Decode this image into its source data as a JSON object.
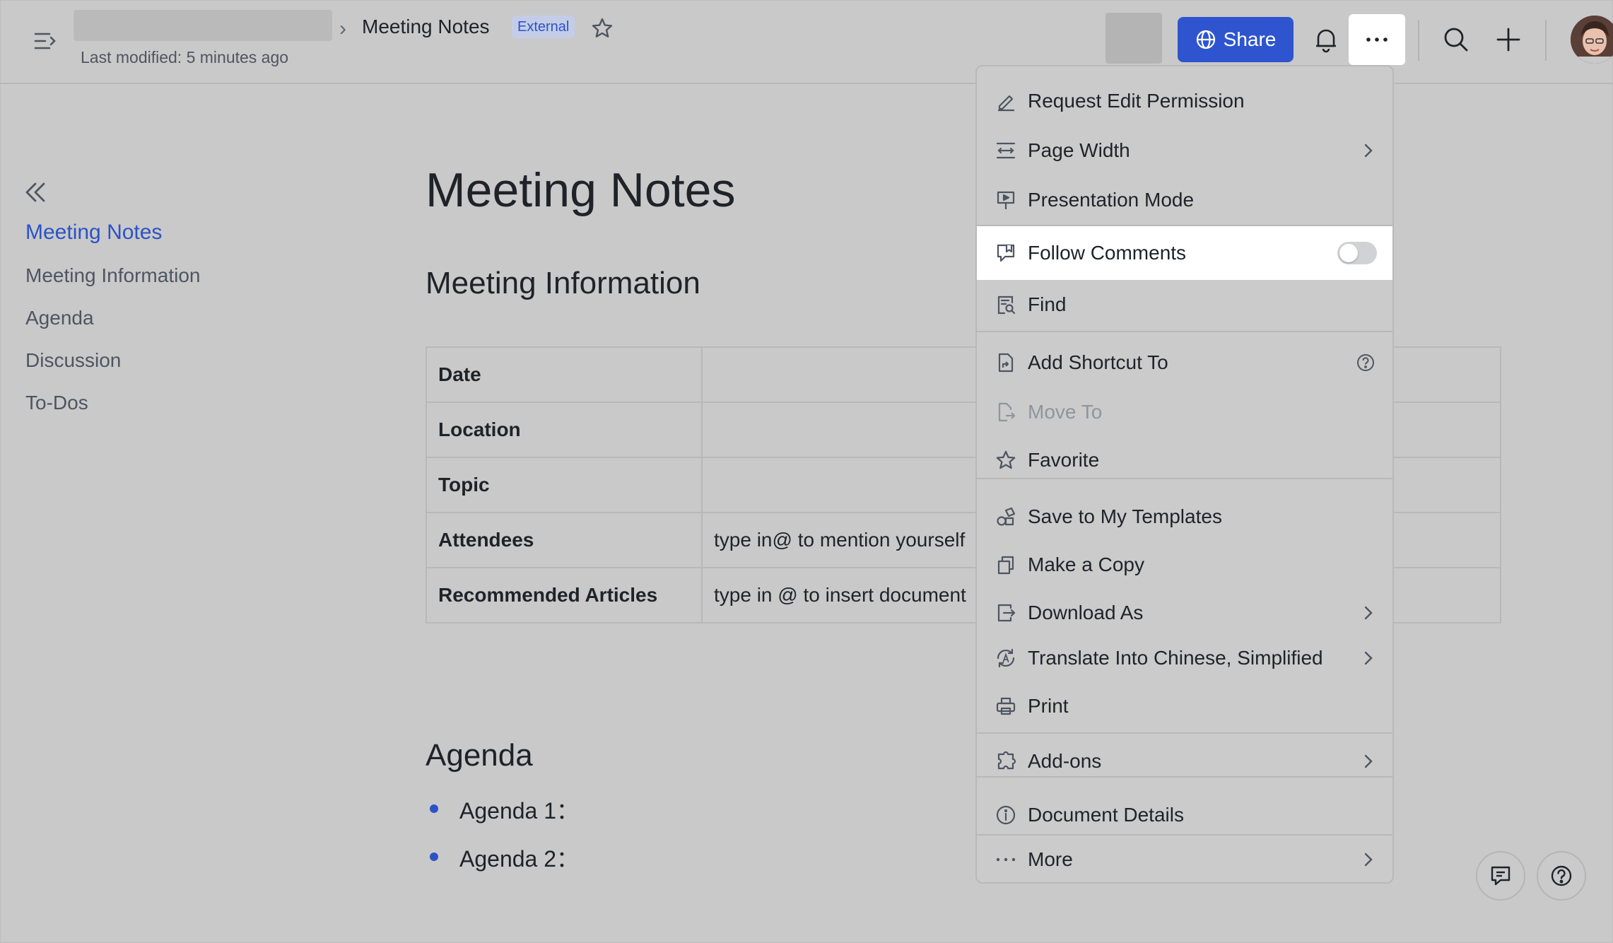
{
  "header": {
    "doc_title": "Meeting Notes",
    "badge": "External",
    "last_modified": "Last modified: 5 minutes ago",
    "share_label": "Share"
  },
  "outline": {
    "items": [
      {
        "label": "Meeting Notes",
        "active": true
      },
      {
        "label": "Meeting Information",
        "active": false
      },
      {
        "label": "Agenda",
        "active": false
      },
      {
        "label": "Discussion",
        "active": false
      },
      {
        "label": "To-Dos",
        "active": false
      }
    ]
  },
  "document": {
    "title": "Meeting Notes",
    "section_meeting_info": "Meeting Information",
    "table": [
      {
        "key": "Date",
        "value": ""
      },
      {
        "key": "Location",
        "value": ""
      },
      {
        "key": "Topic",
        "value": ""
      },
      {
        "key": "Attendees",
        "value": "type in@ to mention yourself"
      },
      {
        "key": "Recommended Articles",
        "value": "type in @ to insert document"
      }
    ],
    "section_agenda": "Agenda",
    "agenda_items": [
      "Agenda 1：",
      "Agenda 2："
    ]
  },
  "menu": {
    "items": [
      {
        "label": "Request Edit Permission",
        "icon": "edit-icon"
      },
      {
        "label": "Page Width",
        "icon": "page-width-icon",
        "submenu": true
      },
      {
        "label": "Presentation Mode",
        "icon": "presentation-icon"
      },
      {
        "label": "Follow Comments",
        "icon": "follow-comments-icon",
        "toggle": false
      },
      {
        "label": "Find",
        "icon": "find-icon"
      },
      {
        "label": "Add Shortcut To",
        "icon": "shortcut-icon",
        "help": true
      },
      {
        "label": "Move To",
        "icon": "move-icon",
        "disabled": true
      },
      {
        "label": "Favorite",
        "icon": "star-icon"
      },
      {
        "label": "Save to My Templates",
        "icon": "template-icon"
      },
      {
        "label": "Make a Copy",
        "icon": "copy-icon"
      },
      {
        "label": "Download As",
        "icon": "download-icon",
        "submenu": true
      },
      {
        "label": "Translate Into Chinese, Simplified",
        "icon": "translate-icon",
        "submenu": true
      },
      {
        "label": "Print",
        "icon": "print-icon"
      },
      {
        "label": "Add-ons",
        "icon": "addons-icon",
        "submenu": true
      },
      {
        "label": "Document Details",
        "icon": "info-icon"
      },
      {
        "label": "More",
        "icon": "more-icon",
        "submenu": true
      }
    ]
  },
  "colors": {
    "accent": "#2e55cf",
    "link": "#2b52c7",
    "background": "#c9c9c9",
    "menu_highlight": "#ffffff"
  }
}
